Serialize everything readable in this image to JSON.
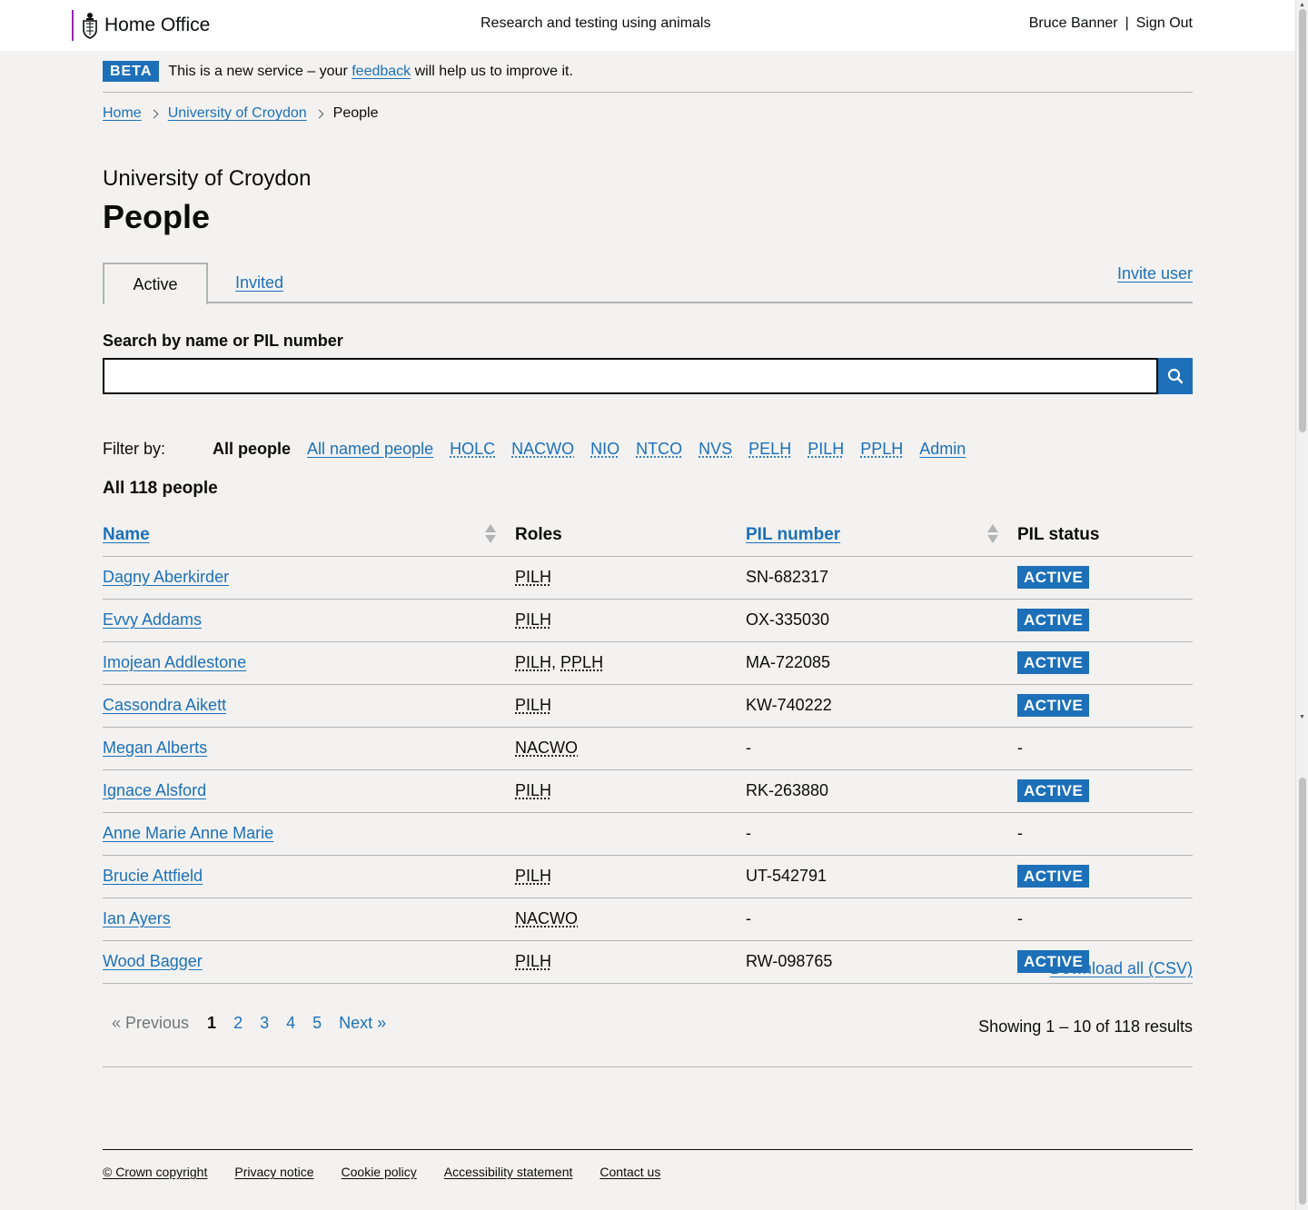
{
  "header": {
    "brand": "Home Office",
    "service": "Research and testing using animals",
    "user": "Bruce Banner",
    "separator": "|",
    "sign_out": "Sign Out"
  },
  "phase": {
    "tag": "BETA",
    "text_before": "This is a new service – your",
    "link": "feedback",
    "text_after": "will help us to improve it."
  },
  "breadcrumbs": [
    "Home",
    "University of Croydon",
    "People"
  ],
  "caption": "University of Croydon",
  "title": "People",
  "tabs": {
    "active": "Active",
    "invited": "Invited",
    "invite_user": "Invite user"
  },
  "search": {
    "label": "Search by name or PIL number",
    "value": "",
    "button_icon": "search-icon"
  },
  "filters": {
    "label": "Filter by:",
    "items": [
      "All people",
      "All named people",
      "HOLC",
      "NACWO",
      "NIO",
      "NTCO",
      "NVS",
      "PELH",
      "PILH",
      "PPLH",
      "Admin"
    ],
    "current": "All people"
  },
  "count": "All 118 people",
  "download": "Download all (CSV)",
  "table": {
    "headers": {
      "name": "Name",
      "roles": "Roles",
      "pil_number": "PIL number",
      "pil_status": "PIL status"
    },
    "rows": [
      {
        "name": "Dagny Aberkirder",
        "roles": [
          "PILH"
        ],
        "pil": "SN-682317",
        "status": "ACTIVE"
      },
      {
        "name": "Evvy Addams",
        "roles": [
          "PILH"
        ],
        "pil": "OX-335030",
        "status": "ACTIVE"
      },
      {
        "name": "Imojean Addlestone",
        "roles": [
          "PILH",
          "PPLH"
        ],
        "pil": "MA-722085",
        "status": "ACTIVE"
      },
      {
        "name": "Cassondra Aikett",
        "roles": [
          "PILH"
        ],
        "pil": "KW-740222",
        "status": "ACTIVE"
      },
      {
        "name": "Megan Alberts",
        "roles": [
          "NACWO"
        ],
        "pil": "-",
        "status": "-"
      },
      {
        "name": "Ignace Alsford",
        "roles": [
          "PILH"
        ],
        "pil": "RK-263880",
        "status": "ACTIVE"
      },
      {
        "name": "Anne Marie Anne Marie",
        "roles": [],
        "pil": "-",
        "status": "-"
      },
      {
        "name": "Brucie Attfield",
        "roles": [
          "PILH"
        ],
        "pil": "UT-542791",
        "status": "ACTIVE"
      },
      {
        "name": "Ian Ayers",
        "roles": [
          "NACWO"
        ],
        "pil": "-",
        "status": "-"
      },
      {
        "name": "Wood Bagger",
        "roles": [
          "PILH"
        ],
        "pil": "RW-098765",
        "status": "ACTIVE"
      }
    ]
  },
  "pagination": {
    "previous": "« Previous",
    "pages": [
      "1",
      "2",
      "3",
      "4",
      "5"
    ],
    "current": "1",
    "next": "Next »",
    "showing": "Showing 1 – 10 of 118 results"
  },
  "footer": {
    "links": [
      "© Crown copyright",
      "Privacy notice",
      "Cookie policy",
      "Accessibility statement",
      "Contact us"
    ]
  },
  "colors": {
    "link": "#1d70b8",
    "brand_bar": "#9325b2",
    "badge": "#1d70b8",
    "background": "#f3f2f1"
  }
}
